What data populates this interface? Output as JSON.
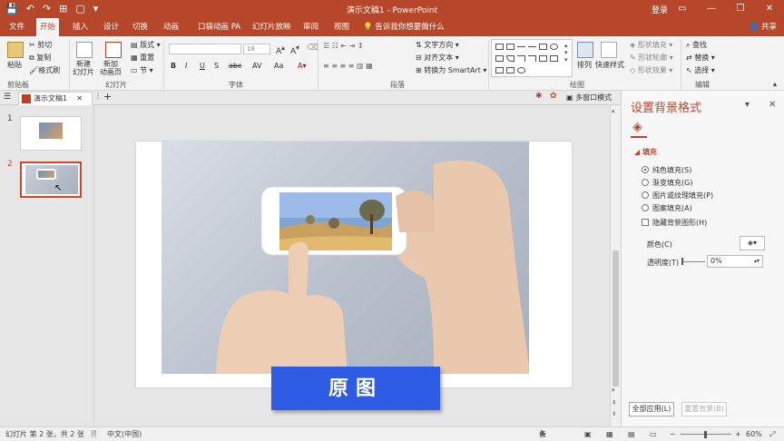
{
  "window": {
    "title": "演示文稿1  -  PowerPoint",
    "login": "登录",
    "controls": [
      "▭",
      "—",
      "❐",
      "✕"
    ]
  },
  "quick_access": [
    "💾",
    "↶",
    "↷",
    "⊞",
    "▢",
    "▾"
  ],
  "tabs": [
    "文件",
    "开始",
    "插入",
    "设计",
    "切换",
    "动画",
    "口袋动画 PA",
    "幻灯片放映",
    "审阅",
    "视图"
  ],
  "active_tab": "开始",
  "tell_me": "告诉我你想要做什么",
  "share": "共享",
  "ribbon": {
    "clipboard": {
      "paste": "粘贴",
      "cut": "剪切",
      "copy": "复制",
      "format_painter": "格式刷",
      "label": "剪贴板"
    },
    "slides": {
      "new_slide": "新建\n幻灯片",
      "new_animation_page": "新加\n动画页",
      "layout": "版式",
      "reset": "重置",
      "section": "节",
      "label": "幻灯片"
    },
    "font": {
      "font_name": "",
      "font_size": "18",
      "bold": "B",
      "italic": "I",
      "underline": "U",
      "shadow": "S",
      "strike": "abc",
      "spacing": "AV",
      "case": "Aa",
      "label": "字体"
    },
    "paragraph": {
      "text_direction": "文字方向",
      "align_text": "对齐文本",
      "smartart": "转换为 SmartArt",
      "label": "段落"
    },
    "drawing": {
      "arrange": "排列",
      "quick_styles": "快速样式",
      "shape_fill": "形状填充",
      "shape_outline": "形状轮廓",
      "shape_effect": "形状效果",
      "label": "绘图"
    },
    "editing": {
      "find": "查找",
      "replace": "替换",
      "select": "选择",
      "label": "编辑"
    }
  },
  "document_tab": "演示文稿1",
  "multi_window": "多窗口模式",
  "slides": [
    {
      "number": "1"
    },
    {
      "number": "2",
      "selected": true
    }
  ],
  "slide_caption": "原图",
  "format_pane": {
    "title": "设置背景格式",
    "section": "填充",
    "options": [
      "纯色填充(S)",
      "渐变填充(G)",
      "图片或纹理填充(P)",
      "图案填充(A)"
    ],
    "selected_option": 0,
    "hide_bg": "隐藏背景图形(H)",
    "color_label": "颜色(C)",
    "transparency_label": "透明度(T)",
    "transparency_value": "0%",
    "apply_all": "全部应用(L)",
    "reset_bg": "重置背景(B)"
  },
  "status": {
    "slide_info": "幻灯片 第 2 张，共 2 张",
    "language": "中文(中国)",
    "notes": "备注",
    "zoom": "60%"
  },
  "colors": {
    "accent": "#b7472a",
    "caption_bg": "#2d5be3"
  }
}
